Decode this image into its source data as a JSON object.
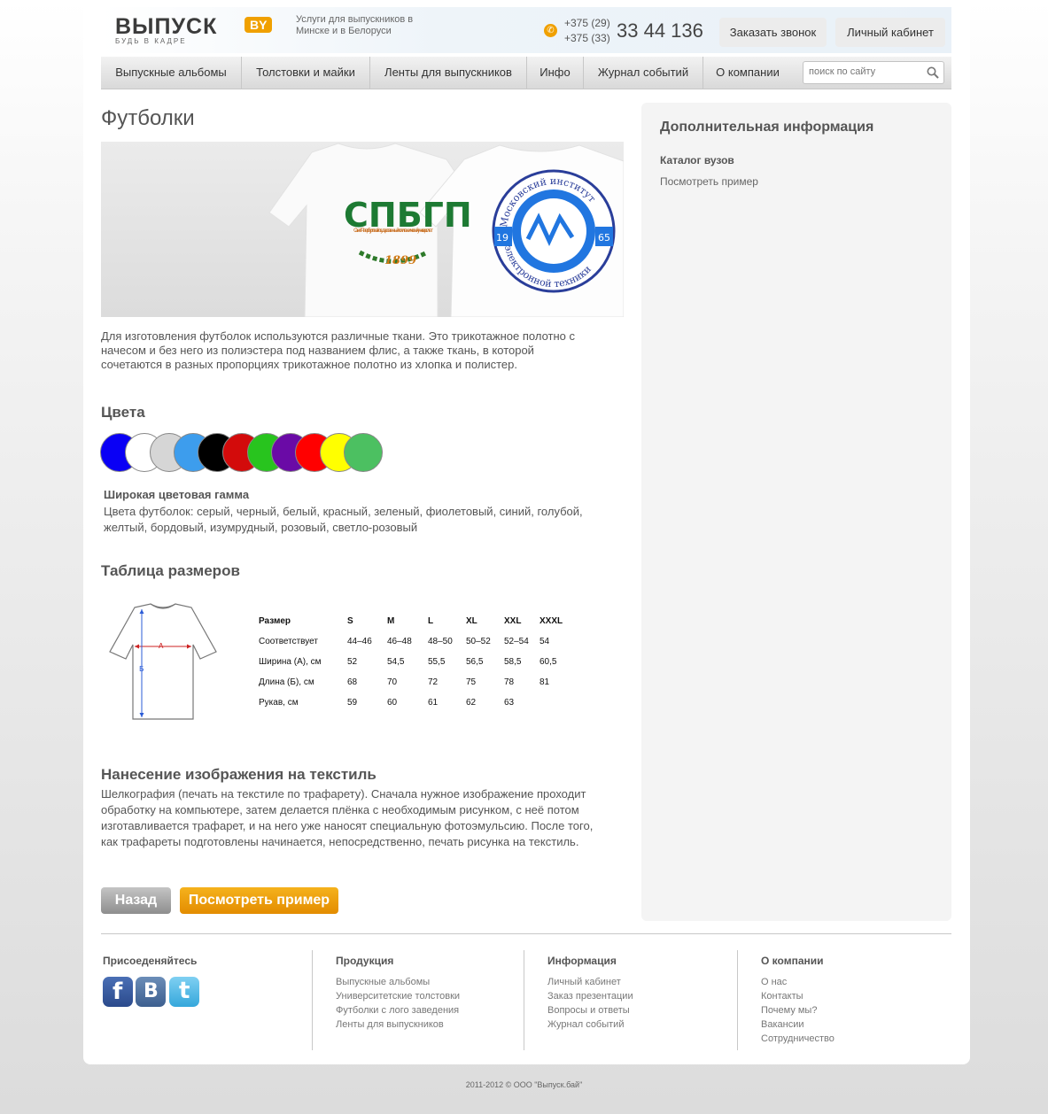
{
  "header": {
    "logo_text": "ВЫПУСК",
    "logo_badge": "BY",
    "logo_tagline": "БУДЬ В КАДРЕ",
    "services": "Услуги для выпускников в Минске и в Белоруси",
    "phone_code_1": "+375 (29)",
    "phone_code_2": "+375 (33)",
    "phone_number": "33 44 136",
    "call_button": "Заказать звонок",
    "cabinet_button": "Личный кабинет"
  },
  "nav": {
    "items": [
      "Выпускные альбомы",
      "Толстовки и майки",
      "Ленты для выпускников",
      "Инфо",
      "Журнал событий",
      "О компании"
    ],
    "search_placeholder": "поиск по сайту"
  },
  "main": {
    "title": "Футболки",
    "banner": {
      "left_shirt_logo": "СПБГП",
      "left_shirt_sub": "Санкт-Петербургский государственный политехнический университет",
      "left_shirt_year": "1899",
      "right_shirt_ring_top": "Московский институт",
      "right_shirt_ring_bottom": "электронной техники",
      "right_shirt_year_left": "19",
      "right_shirt_year_right": "65"
    },
    "intro": "Для изготовления футболок используются различные ткани. Это трикотажное полотно с начесом и без него из полиэстера под названием флис, а также ткань, в которой сочетаются в разных пропорциях трикотажное полотно из хлопка и полистер.",
    "colors_heading": "Цвета",
    "swatch_colors": [
      "#0a00f5",
      "#ffffff",
      "#d6d6d6",
      "#3d9ded",
      "#000000",
      "#d30b0b",
      "#28c41e",
      "#6a0aa6",
      "#ff0000",
      "#ffff00",
      "#4cc061"
    ],
    "colors_subheading": "Широкая цветовая гамма",
    "colors_text": "Цвета футболок: серый, черный, белый, красный, зеленый, фиолетовый, синий, голубой, желтый, бордовый, изумрудный, розовый, светло-розовый",
    "sizes_heading": "Таблица размеров",
    "diagram_label_a": "А",
    "diagram_label_b": "Б",
    "size_table": {
      "header": [
        "Размер",
        "S",
        "M",
        "L",
        "XL",
        "XXL",
        "XXXL"
      ],
      "rows": [
        [
          "Соответствует",
          "44–46",
          "46–48",
          "48–50",
          "50–52",
          "52–54",
          "54"
        ],
        [
          "Ширина (А), см",
          "52",
          "54,5",
          "55,5",
          "56,5",
          "58,5",
          "60,5"
        ],
        [
          "Длина (Б), см",
          "68",
          "70",
          "72",
          "75",
          "78",
          "81"
        ],
        [
          "Рукав, см",
          "59",
          "60",
          "61",
          "62",
          "63",
          ""
        ]
      ]
    },
    "print_heading": "Нанесение изображения на текстиль",
    "print_text": "Шелкография (печать на текстиле по трафарету). Сначала нужное изображение проходит обработку на компьютере, затем делается плёнка с необходимым рисунком, с неё потом изготавливается трафарет, и на него уже наносят специальную фотоэмульсию. После того, как трафареты подготовлены начинается, непосредственно, печать рисунка на текстиль.",
    "back_button": "Назад",
    "example_button": "Посмотреть пример"
  },
  "sidebar": {
    "title": "Дополнительная информация",
    "subtitle": "Каталог вузов",
    "link": "Посмотреть пример"
  },
  "footer": {
    "join_heading": "Присоеденяйтесь",
    "social": [
      "f",
      "B",
      "t"
    ],
    "columns": [
      {
        "heading": "Продукция",
        "links": [
          "Выпускные альбомы",
          "Университетские толстовки",
          "Футболки с лого заведения",
          "Ленты для выпускников"
        ]
      },
      {
        "heading": "Информация",
        "links": [
          "Личный кабинет",
          "Заказ презентации",
          "Вопросы и ответы",
          "Журнал событий"
        ]
      },
      {
        "heading": "О компании",
        "links": [
          "О нас",
          "Контакты",
          "Почему мы?",
          "Вакансии",
          "Сотрудничество"
        ]
      }
    ],
    "copyright": "2011-2012 © ООО \"Выпуск.бай\""
  }
}
